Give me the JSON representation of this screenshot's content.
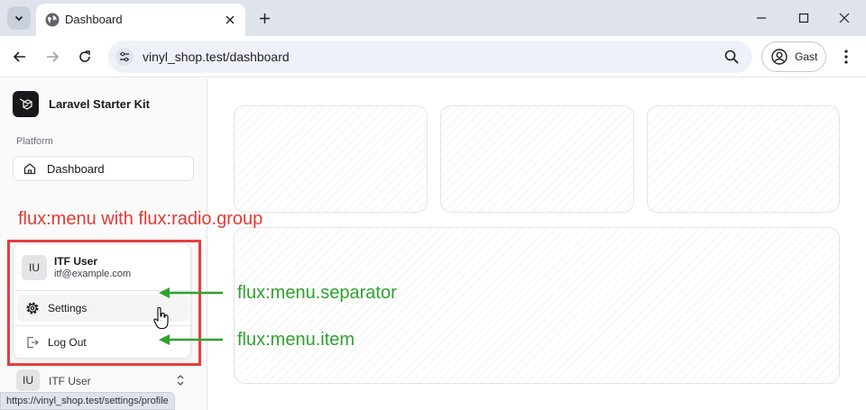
{
  "browser": {
    "tab_title": "Dashboard",
    "url": "vinyl_shop.test/dashboard",
    "profile_label": "Gast",
    "status_url": "https://vinyl_shop.test/settings/profile",
    "icons": [
      "chevron-down-icon",
      "globe-icon",
      "close-icon",
      "plus-icon",
      "minimize-icon",
      "maximize-icon",
      "back-icon",
      "forward-icon",
      "reload-icon",
      "tune-icon",
      "zoom-icon",
      "profile-icon",
      "more-vert-icon"
    ]
  },
  "sidebar": {
    "brand": "Laravel Starter Kit",
    "section_heading": "Platform",
    "items": [
      {
        "label": "Dashboard",
        "icon": "home-icon"
      }
    ]
  },
  "user_menu": {
    "initials": "IU",
    "name": "ITF User",
    "email": "itf@example.com",
    "items": [
      {
        "label": "Settings",
        "icon": "gear-icon"
      },
      {
        "label": "Log Out",
        "icon": "logout-icon"
      }
    ]
  },
  "user_trigger": {
    "initials": "IU",
    "name": "ITF User",
    "icon": "chevrons-up-down-icon"
  },
  "annotations": {
    "title": "flux:menu with flux:radio.group",
    "separator_label": "flux:menu.separator",
    "item_label": "flux:menu.item"
  },
  "colors": {
    "annotation_red": "#e53935",
    "annotation_green": "#2ea12e",
    "brand_dark": "#18181b"
  }
}
